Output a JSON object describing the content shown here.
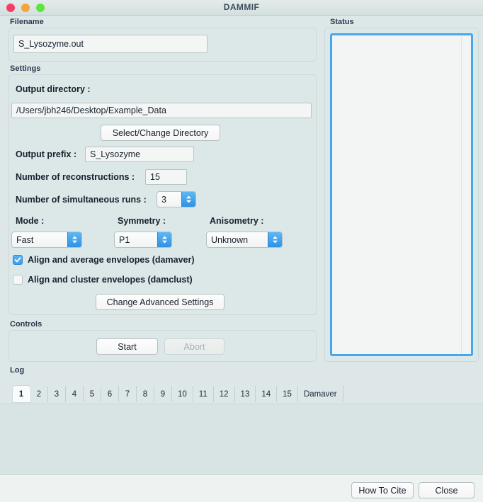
{
  "window": {
    "title": "DAMMIF",
    "traffic_lights": [
      {
        "name": "close",
        "color": "#f53e63"
      },
      {
        "name": "minimize",
        "color": "#f5a33a"
      },
      {
        "name": "maximize",
        "color": "#5ce53a"
      }
    ]
  },
  "filename_group": {
    "label": "Filename",
    "value": "S_Lysozyme.out"
  },
  "settings_group": {
    "label": "Settings",
    "output_directory_label": "Output directory :",
    "output_directory_value": "/Users/jbh246/Desktop/Example_Data",
    "select_directory_button": "Select/Change Directory",
    "output_prefix_label": "Output prefix :",
    "output_prefix_value": "S_Lysozyme",
    "reconstructions_label": "Number of reconstructions :",
    "reconstructions_value": "15",
    "simultaneous_runs_label": "Number of simultaneous runs :",
    "simultaneous_runs_value": "3",
    "mode_label": "Mode :",
    "mode_value": "Fast",
    "symmetry_label": "Symmetry :",
    "symmetry_value": "P1",
    "anisometry_label": "Anisometry :",
    "anisometry_value": "Unknown",
    "damaver_checkbox_label": "Align and average envelopes (damaver)",
    "damaver_checked": true,
    "damclust_checkbox_label": "Align and cluster envelopes (damclust)",
    "damclust_checked": false,
    "advanced_settings_button": "Change Advanced Settings"
  },
  "controls_group": {
    "label": "Controls",
    "start_button": "Start",
    "abort_button": "Abort",
    "abort_disabled": true
  },
  "status_group": {
    "label": "Status",
    "content": "",
    "border_color": "#45a8ef"
  },
  "log_group": {
    "label": "Log",
    "tabs": [
      "1",
      "2",
      "3",
      "4",
      "5",
      "6",
      "7",
      "8",
      "9",
      "10",
      "11",
      "12",
      "13",
      "14",
      "15",
      "Damaver"
    ],
    "selected_tab": "1",
    "content": ""
  },
  "footer": {
    "how_to_cite_button": "How To Cite",
    "close_button": "Close"
  }
}
